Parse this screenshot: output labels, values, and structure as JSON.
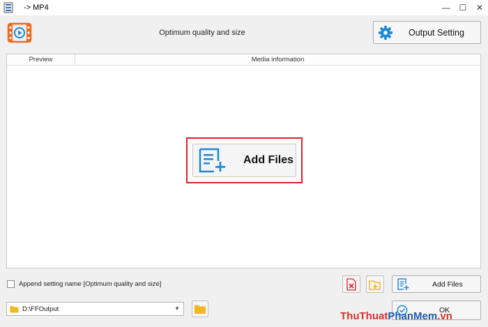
{
  "window": {
    "title": "-> MP4",
    "controls": {
      "minimize": "—",
      "restore": "☐",
      "close": "✕"
    }
  },
  "header": {
    "preset_name": "Optimum quality and size",
    "output_setting_label": "Output Setting"
  },
  "file_list": {
    "columns": [
      "Preview",
      "Media information"
    ],
    "add_files_label": "Add Files"
  },
  "footer": {
    "append_setting_label": "Append setting name [Optimum quality and size]",
    "append_setting_checked": false,
    "add_files_label": "Add Files",
    "output_folder": "D:\\FFOutput",
    "ok_label": "OK"
  },
  "watermark": {
    "part1": "ThuThuat",
    "part2": "PhanMem",
    "part3": ".vn"
  },
  "colors": {
    "accent_blue": "#1e88d6",
    "highlight_red": "#e0202a",
    "format_orange": "#ee6a1e",
    "folder_yellow": "#f2b824"
  },
  "icons": {
    "app": "app-icon",
    "format": "video-icon",
    "gear": "gear-icon",
    "add_files": "add-file-icon",
    "remove": "remove-file-icon",
    "add_folder": "add-folder-icon",
    "folder": "folder-icon",
    "ok": "check-circle-icon"
  }
}
